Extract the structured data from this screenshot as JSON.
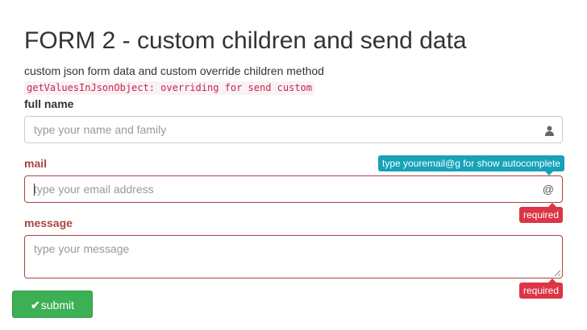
{
  "page": {
    "title": "FORM 2 - custom children and send data",
    "subtitle": "custom json form data and custom override children method",
    "code_note": "getValuesInJsonObject: overriding for send custom"
  },
  "fields": {
    "full_name": {
      "label": "full name",
      "placeholder": "type your name and family",
      "value": "",
      "icon": "user-icon",
      "icon_glyph": "👤",
      "state": "default"
    },
    "mail": {
      "label": "mail",
      "placeholder": "type your email address",
      "value": "",
      "icon": "at-sign-icon",
      "icon_glyph": "@",
      "state": "error",
      "hint": "type youremail@g for show autocomplete",
      "error": "required"
    },
    "message": {
      "label": "message",
      "placeholder": "type your message",
      "value": "",
      "state": "error",
      "error": "required"
    }
  },
  "actions": {
    "submit_label": "submit",
    "submit_icon": "check-icon",
    "submit_icon_glyph": "✔"
  },
  "colors": {
    "error": "#a94442",
    "error_badge": "#dc3545",
    "info_badge": "#17a2b8",
    "submit": "#3cb054",
    "code_text": "#c7254e",
    "code_bg": "#f9f2f4"
  }
}
